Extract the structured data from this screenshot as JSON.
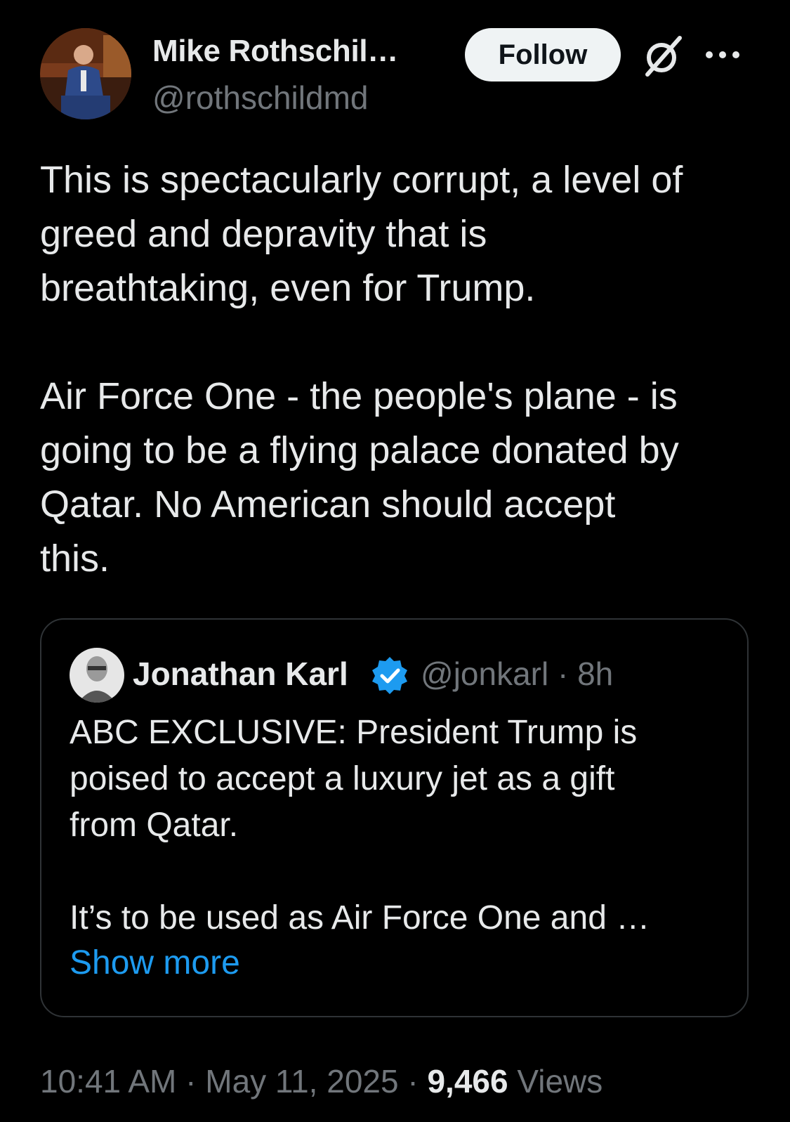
{
  "author": {
    "name": "Mike Rothschil…",
    "handle": "@rothschildmd"
  },
  "header": {
    "follow_label": "Follow"
  },
  "tweet": {
    "text": "This is spectacularly corrupt, a level of\ngreed and depravity that is\nbreathtaking, even for Trump.\n\nAir Force One - the people's plane - is\ngoing to be a flying palace donated by\nQatar. No American should accept\nthis."
  },
  "quote": {
    "name": "Jonathan Karl",
    "handle": "@jonkarl",
    "separator": "·",
    "time": "8h",
    "text": "ABC EXCLUSIVE: President Trump is\npoised to accept a luxury jet as a gift\nfrom Qatar.\n\nIt’s to be used as Air Force One and …",
    "show_more": "Show more"
  },
  "footer": {
    "time": "10:41 AM",
    "date": "May 11, 2025",
    "views_count": "9,466",
    "views_label": "Views",
    "separator": "·"
  },
  "colors": {
    "background": "#000000",
    "primary_text": "#e7e9ea",
    "secondary_text": "#71767b",
    "link": "#1d9bf0",
    "verified": "#1d9bf0",
    "border": "#2f3336",
    "follow_button_bg": "#eff3f4"
  },
  "icons": {
    "grok": "grok-icon",
    "more": "more-icon",
    "verified": "verified-badge-icon"
  }
}
